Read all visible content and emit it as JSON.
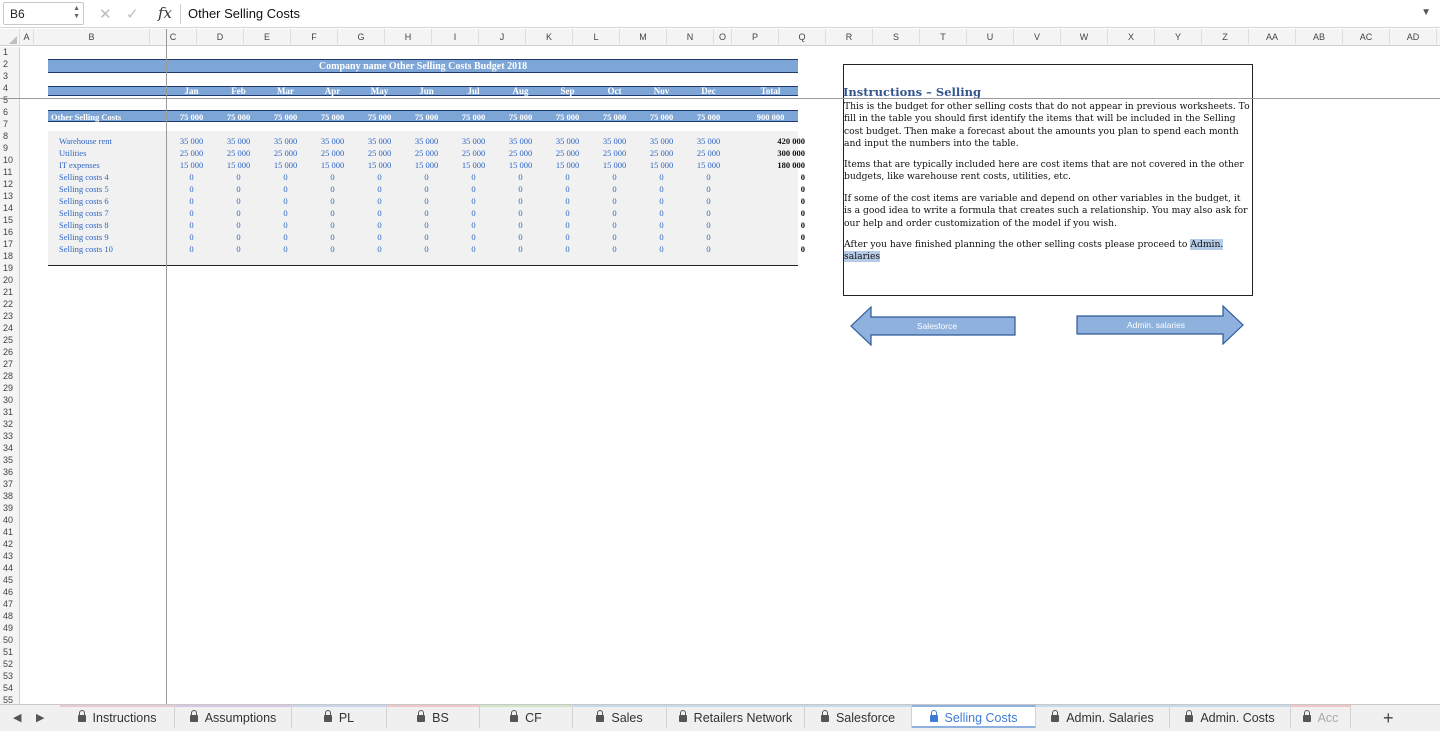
{
  "formula_bar": {
    "cell_ref": "B6",
    "fx": "fx",
    "content": "Other Selling Costs",
    "cancel_icon": "close-icon",
    "confirm_icon": "checkmark-icon"
  },
  "columns": [
    "A",
    "B",
    "C",
    "D",
    "E",
    "F",
    "G",
    "H",
    "I",
    "J",
    "K",
    "L",
    "M",
    "N",
    "O",
    "P",
    "Q",
    "R",
    "S",
    "T",
    "U",
    "V",
    "W",
    "X",
    "Y",
    "Z",
    "AA",
    "AB",
    "AC",
    "AD"
  ],
  "rows": [
    "1",
    "2",
    "3",
    "4",
    "5",
    "6",
    "7",
    "8",
    "9",
    "10",
    "11",
    "12",
    "13",
    "14",
    "15",
    "16",
    "17",
    "18",
    "19",
    "20",
    "21",
    "22",
    "23",
    "24",
    "25",
    "26",
    "27",
    "28",
    "29",
    "30",
    "31",
    "32",
    "33",
    "34",
    "35",
    "36",
    "37",
    "38",
    "39",
    "40",
    "41",
    "42",
    "43",
    "44",
    "45",
    "46",
    "47",
    "48",
    "49",
    "50",
    "51",
    "52",
    "53",
    "54",
    "55"
  ],
  "budget": {
    "title": "Company name Other Selling Costs Budget 2018",
    "months": [
      "Jan",
      "Feb",
      "Mar",
      "Apr",
      "May",
      "Jun",
      "Jul",
      "Aug",
      "Sep",
      "Oct",
      "Nov",
      "Dec"
    ],
    "total_header": "Total",
    "total_row": {
      "label": "Other Selling Costs",
      "values": [
        "75 000",
        "75 000",
        "75 000",
        "75 000",
        "75 000",
        "75 000",
        "75 000",
        "75 000",
        "75 000",
        "75 000",
        "75 000",
        "75 000"
      ],
      "total": "900 000"
    },
    "lines": [
      {
        "label": "Warehouse rent",
        "values": [
          "35 000",
          "35 000",
          "35 000",
          "35 000",
          "35 000",
          "35 000",
          "35 000",
          "35 000",
          "35 000",
          "35 000",
          "35 000",
          "35 000"
        ],
        "total": "420 000"
      },
      {
        "label": "Utilities",
        "values": [
          "25 000",
          "25 000",
          "25 000",
          "25 000",
          "25 000",
          "25 000",
          "25 000",
          "25 000",
          "25 000",
          "25 000",
          "25 000",
          "25 000"
        ],
        "total": "300 000"
      },
      {
        "label": "IT expenses",
        "values": [
          "15 000",
          "15 000",
          "15 000",
          "15 000",
          "15 000",
          "15 000",
          "15 000",
          "15 000",
          "15 000",
          "15 000",
          "15 000",
          "15 000"
        ],
        "total": "180 000"
      },
      {
        "label": "Selling costs 4",
        "values": [
          "0",
          "0",
          "0",
          "0",
          "0",
          "0",
          "0",
          "0",
          "0",
          "0",
          "0",
          "0"
        ],
        "total": "0"
      },
      {
        "label": "Selling costs 5",
        "values": [
          "0",
          "0",
          "0",
          "0",
          "0",
          "0",
          "0",
          "0",
          "0",
          "0",
          "0",
          "0"
        ],
        "total": "0"
      },
      {
        "label": "Selling costs 6",
        "values": [
          "0",
          "0",
          "0",
          "0",
          "0",
          "0",
          "0",
          "0",
          "0",
          "0",
          "0",
          "0"
        ],
        "total": "0"
      },
      {
        "label": "Selling costs 7",
        "values": [
          "0",
          "0",
          "0",
          "0",
          "0",
          "0",
          "0",
          "0",
          "0",
          "0",
          "0",
          "0"
        ],
        "total": "0"
      },
      {
        "label": "Selling costs 8",
        "values": [
          "0",
          "0",
          "0",
          "0",
          "0",
          "0",
          "0",
          "0",
          "0",
          "0",
          "0",
          "0"
        ],
        "total": "0"
      },
      {
        "label": "Selling costs 9",
        "values": [
          "0",
          "0",
          "0",
          "0",
          "0",
          "0",
          "0",
          "0",
          "0",
          "0",
          "0",
          "0"
        ],
        "total": "0"
      },
      {
        "label": "Selling costs 10",
        "values": [
          "0",
          "0",
          "0",
          "0",
          "0",
          "0",
          "0",
          "0",
          "0",
          "0",
          "0",
          "0"
        ],
        "total": "0"
      }
    ]
  },
  "instructions": {
    "title": "Instructions – Selling",
    "p1": "This is the budget for other selling costs that do not appear in previous worksheets. To fill in the table you should first identify the items that will be included in the Selling cost budget. Then make a forecast about the amounts you plan to spend each month and input the numbers into the table.",
    "p2": "Items that are typically included here are cost items that are not covered in the other budgets, like warehouse rent costs, utilities, etc.",
    "p3": "If some of the cost items are variable and depend on other variables in the budget, it is a good idea to write a formula that creates such a relationship. You may also ask for our help and order customization of the model if you wish.",
    "p4_text": "After you have finished planning the other selling costs please proceed to ",
    "p4_link": "Admin. salaries"
  },
  "nav_arrows": {
    "back_label": "Salesforce",
    "forward_label": "Admin. salaries",
    "color": "#8eb1de"
  },
  "tabs": [
    {
      "label": "Instructions",
      "active": false
    },
    {
      "label": "Assumptions",
      "active": false
    },
    {
      "label": "PL",
      "active": false
    },
    {
      "label": "BS",
      "active": false
    },
    {
      "label": "CF",
      "active": false
    },
    {
      "label": "Sales",
      "active": false
    },
    {
      "label": "Retailers Network",
      "active": false
    },
    {
      "label": "Salesforce",
      "active": false
    },
    {
      "label": "Selling Costs",
      "active": true
    },
    {
      "label": "Admin. Salaries",
      "active": false
    },
    {
      "label": "Admin. Costs",
      "active": false
    },
    {
      "label": "Acc",
      "active": false
    }
  ],
  "tab_accent_colors": [
    "#e9c9d8",
    "#d9c6e6",
    "#c9d6ef",
    "#f0c6c6",
    "#cfe6c6",
    "#c6d9ef",
    "#c6d9ef",
    "#c6d9ef",
    "#8eb1de",
    "#c6d9ef",
    "#c6d9ef",
    "#f0c6c6"
  ],
  "add_sheet_label": "+"
}
